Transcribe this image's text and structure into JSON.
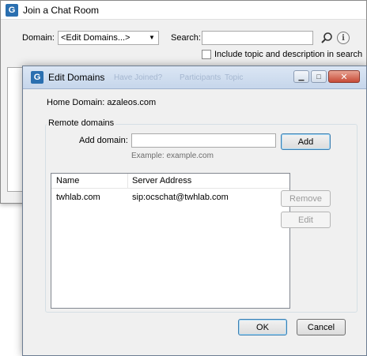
{
  "back_window": {
    "app_icon": "G",
    "title": "Join a Chat Room",
    "domain_label": "Domain:",
    "domain_value": "<Edit Domains...>",
    "search_label": "Search:",
    "search_value": "",
    "checkbox_label": "Include topic and description in search",
    "info_icon": "i"
  },
  "dialog": {
    "app_icon": "G",
    "title": "Edit Domains",
    "ghost_tabs": [
      "Have Joined?",
      "Participants",
      "Topic"
    ],
    "home_domain": "Home Domain: azaleos.com",
    "remote_group_label": "Remote domains",
    "add_domain_label": "Add domain:",
    "add_domain_value": "",
    "add_domain_example": "Example: example.com",
    "add_button": "Add",
    "remove_button": "Remove",
    "edit_button": "Edit",
    "ok_button": "OK",
    "cancel_button": "Cancel",
    "list": {
      "columns": [
        "Name",
        "Server Address"
      ],
      "rows": [
        [
          "twhlab.com",
          "sip:ocschat@twhlab.com"
        ]
      ]
    }
  },
  "colors": {
    "accent": "#2a6fb0",
    "close_button": "#c74a36",
    "disabled_text": "#9a9a9a"
  }
}
